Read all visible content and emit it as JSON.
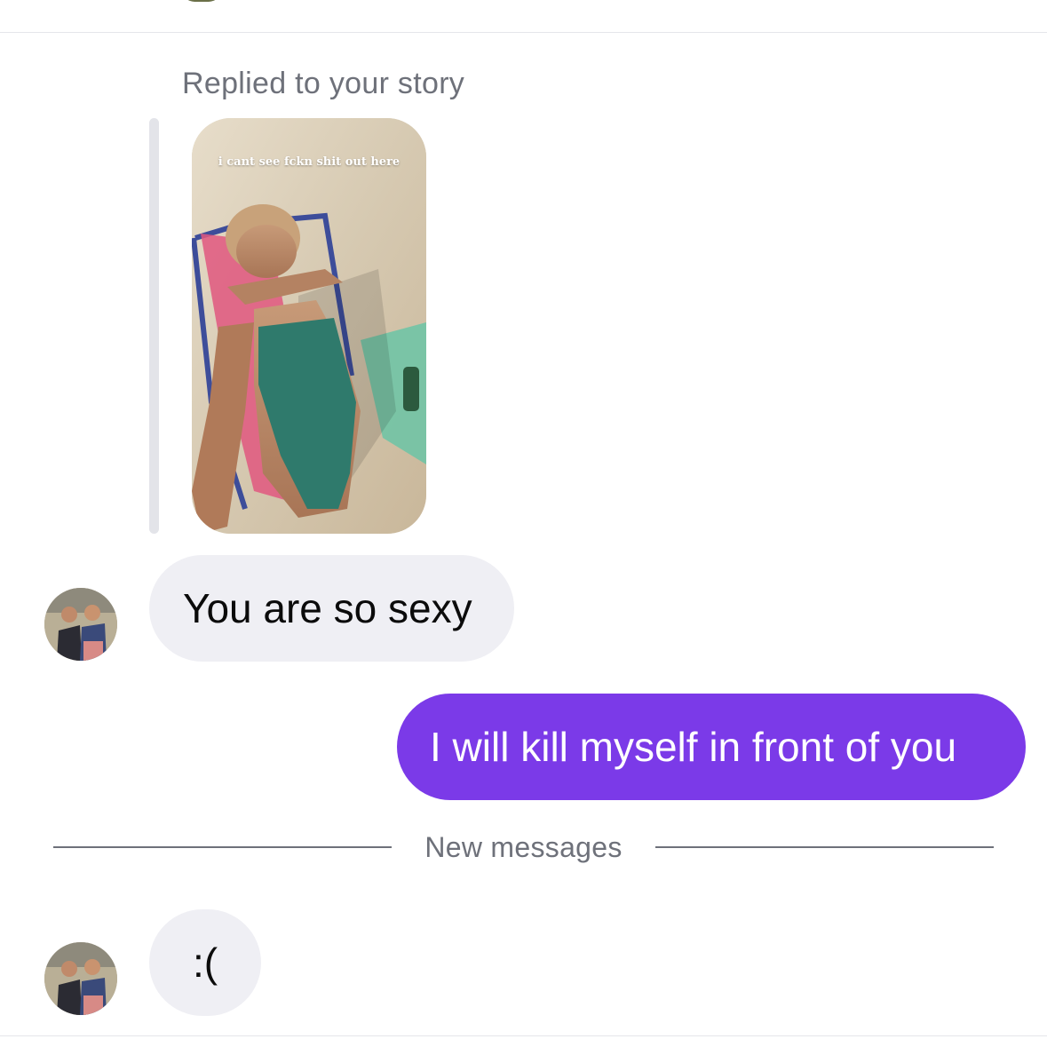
{
  "story_reply": {
    "label": "Replied to your story",
    "story_caption": "i cant see fckn shit out here"
  },
  "messages": [
    {
      "direction": "incoming",
      "text": "You are so sexy"
    },
    {
      "direction": "outgoing",
      "text": "I will kill myself in front of you"
    },
    {
      "direction": "incoming",
      "text": ":("
    }
  ],
  "separator": {
    "label": "New messages"
  },
  "colors": {
    "outgoing_bubble": "#7b3ae8",
    "incoming_bubble": "#efeff4",
    "secondary_text": "#6e717a"
  }
}
